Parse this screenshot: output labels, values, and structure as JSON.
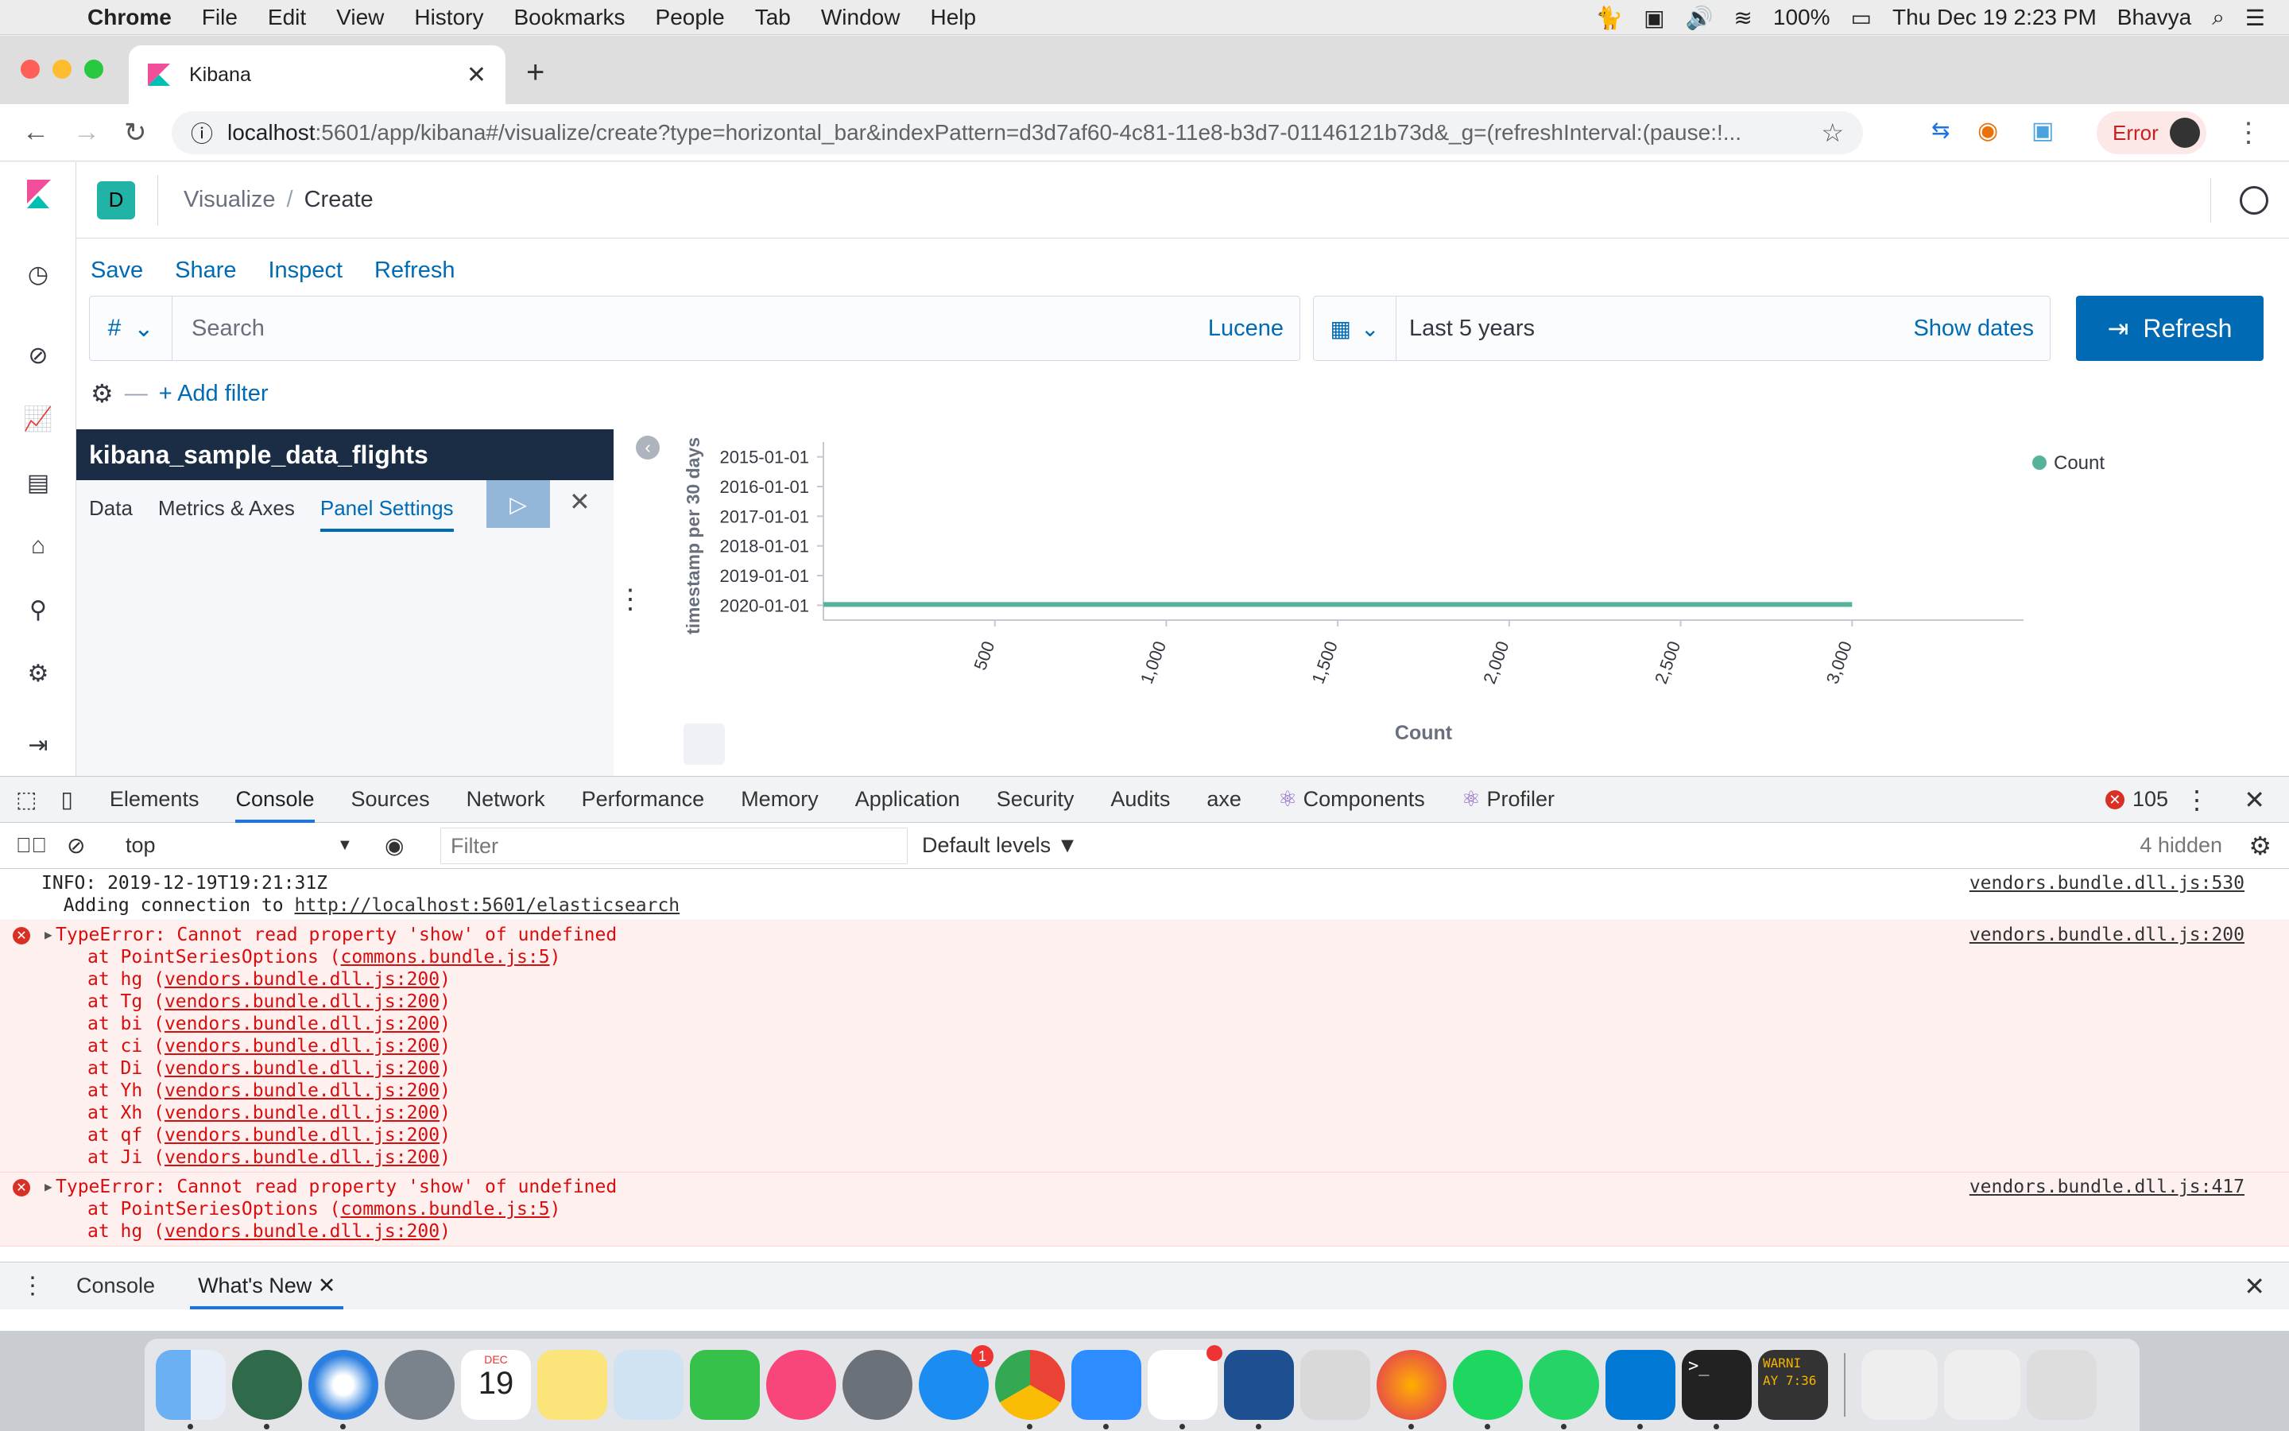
{
  "menubar": {
    "app": "Chrome",
    "items": [
      "File",
      "Edit",
      "View",
      "History",
      "Bookmarks",
      "People",
      "Tab",
      "Window",
      "Help"
    ],
    "battery": "100%",
    "datetime": "Thu Dec 19  2:23 PM",
    "user": "Bhavya"
  },
  "browser": {
    "tab_title": "Kibana",
    "url_host": "localhost",
    "url_path": ":5601/app/kibana#/visualize/create?type=horizontal_bar&indexPattern=d3d7af60-4c81-11e8-b3d7-01146121b73d&_g=(refreshInterval:(pause:!...",
    "error_label": "Error"
  },
  "kibana": {
    "space_letter": "D",
    "breadcrumb": [
      "Visualize",
      "Create"
    ],
    "top_nav": [
      "Save",
      "Share",
      "Inspect",
      "Refresh"
    ],
    "query": {
      "lang_symbol": "#",
      "placeholder": "Search",
      "language": "Lucene"
    },
    "time": {
      "range": "Last 5 years",
      "show_dates": "Show dates"
    },
    "refresh_button": "Refresh",
    "add_filter": "+ Add filter",
    "index_pattern": "kibana_sample_data_flights",
    "editor_tabs": [
      "Data",
      "Metrics & Axes",
      "Panel Settings"
    ],
    "active_editor_tab": "Panel Settings",
    "colors": {
      "primary": "#006bb4",
      "accent": "#20b3a6",
      "panel_header": "#1a2d45"
    }
  },
  "chart_data": {
    "type": "bar",
    "orientation": "horizontal",
    "categories": [
      "2015-01-01",
      "2016-01-01",
      "2017-01-01",
      "2018-01-01",
      "2019-01-01",
      "2020-01-01"
    ],
    "series": [
      {
        "name": "Count",
        "color": "#54b399",
        "values": [
          0,
          0,
          0,
          0,
          0,
          3000
        ]
      }
    ],
    "xlabel": "Count",
    "ylabel": "timestamp per 30 days",
    "x_ticks": [
      "500",
      "1,000",
      "1,500",
      "2,000",
      "2,500",
      "3,000"
    ],
    "xlim": [
      0,
      3500
    ],
    "legend": "top-right"
  },
  "devtools": {
    "tabs": [
      "Elements",
      "Console",
      "Sources",
      "Network",
      "Performance",
      "Memory",
      "Application",
      "Security",
      "Audits",
      "axe",
      "Components",
      "Profiler"
    ],
    "active_tab": "Console",
    "error_count": "105",
    "context": "top",
    "filter_placeholder": "Filter",
    "levels": "Default levels ▼",
    "hidden": "4 hidden",
    "messages": [
      {
        "type": "info",
        "line1": "INFO: 2019-12-19T19:21:31Z",
        "line2_prefix": "  Adding connection to ",
        "link": "http://localhost:5601/elasticsearch",
        "source": "vendors.bundle.dll.js:530"
      },
      {
        "type": "error",
        "text": "TypeError: Cannot read property 'show' of undefined",
        "source": "vendors.bundle.dll.js:200",
        "stack": [
          {
            "fn": "PointSeriesOptions",
            "loc": "commons.bundle.js:5"
          },
          {
            "fn": "hg",
            "loc": "vendors.bundle.dll.js:200"
          },
          {
            "fn": "Tg",
            "loc": "vendors.bundle.dll.js:200"
          },
          {
            "fn": "bi",
            "loc": "vendors.bundle.dll.js:200"
          },
          {
            "fn": "ci",
            "loc": "vendors.bundle.dll.js:200"
          },
          {
            "fn": "Di",
            "loc": "vendors.bundle.dll.js:200"
          },
          {
            "fn": "Yh",
            "loc": "vendors.bundle.dll.js:200"
          },
          {
            "fn": "Xh",
            "loc": "vendors.bundle.dll.js:200"
          },
          {
            "fn": "qf",
            "loc": "vendors.bundle.dll.js:200"
          },
          {
            "fn": "Ji",
            "loc": "vendors.bundle.dll.js:200"
          }
        ]
      },
      {
        "type": "error",
        "text": "TypeError: Cannot read property 'show' of undefined",
        "source": "vendors.bundle.dll.js:417",
        "stack": [
          {
            "fn": "PointSeriesOptions",
            "loc": "commons.bundle.js:5"
          },
          {
            "fn": "hg",
            "loc": "vendors.bundle.dll.js:200"
          }
        ]
      }
    ],
    "drawer_tabs": [
      "Console",
      "What's New"
    ]
  },
  "dock": {
    "icons": [
      "finder-icon",
      "atom-icon",
      "safari-icon",
      "launchpad-icon",
      "calendar-icon",
      "notes-icon",
      "preview-icon",
      "facetime-icon",
      "music-icon",
      "system-preferences-icon",
      "app-store-icon",
      "chrome-icon",
      "zoom-icon",
      "slack-icon",
      "virtualbox-icon",
      "screen-recorder-icon",
      "firefox-icon",
      "spotify-icon",
      "whatsapp-icon",
      "vscode-icon",
      "terminal-icon",
      "console-icon"
    ],
    "calendar_month": "DEC",
    "calendar_day": "19",
    "app_store_badge": "1",
    "console_text": "WARNI",
    "console_time": "AY 7:36"
  }
}
